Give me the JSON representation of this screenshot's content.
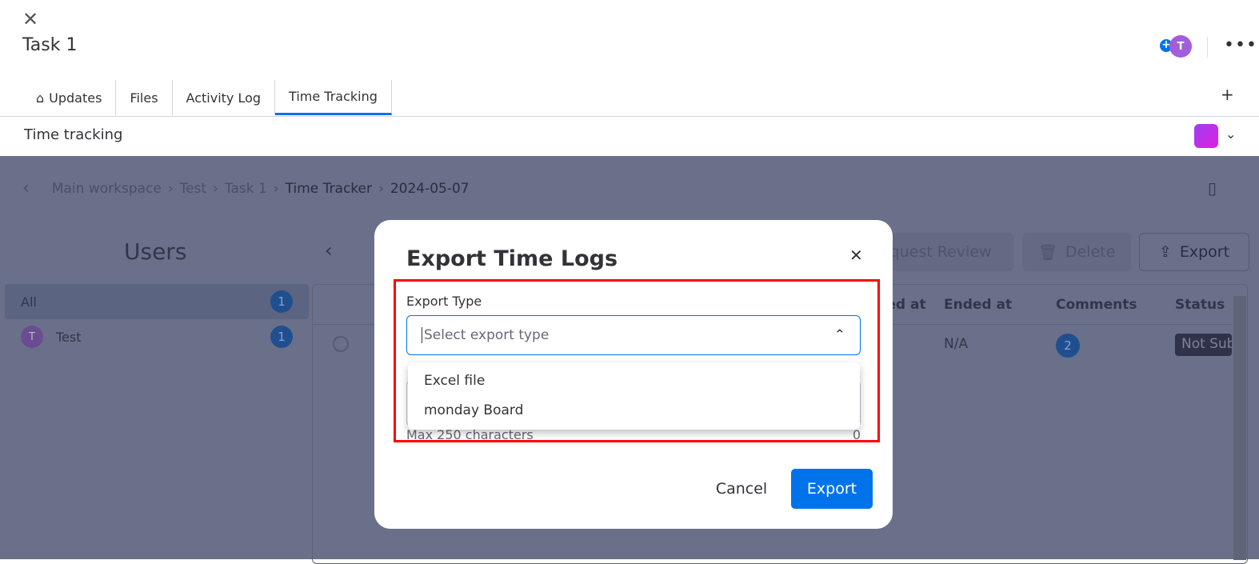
{
  "header": {
    "title": "Task 1",
    "avatar_initial": "T",
    "more": "•••",
    "add_tab": "+"
  },
  "tabs": [
    {
      "label": "Updates"
    },
    {
      "label": "Files"
    },
    {
      "label": "Activity Log"
    },
    {
      "label": "Time Tracking",
      "active": true
    }
  ],
  "section": {
    "title": "Time tracking"
  },
  "breadcrumb": [
    "Main workspace",
    "Test",
    "Task 1",
    "Time Tracker",
    "2024-05-07"
  ],
  "users": {
    "title": "Users",
    "items": [
      {
        "label": "All",
        "count": "1"
      },
      {
        "label": "Test",
        "initial": "T",
        "count": "1"
      }
    ]
  },
  "toolbar": {
    "request_review": "Request Review",
    "delete": "Delete",
    "export": "Export"
  },
  "table": {
    "headers": [
      "Started at",
      "Ended at",
      "Comments",
      "Status"
    ],
    "row": {
      "ended": "N/A",
      "comments": "2",
      "status": "Not Submitted"
    }
  },
  "modal": {
    "title": "Export Time Logs",
    "field_label": "Export Type",
    "placeholder": "Select export type",
    "options": [
      "Excel file",
      "monday Board"
    ],
    "max_chars": "Max 250 characters",
    "char_count": "0",
    "cancel": "Cancel",
    "export": "Export"
  },
  "colors": {
    "accent": "#0073ea",
    "highlight": "#ff0000"
  }
}
